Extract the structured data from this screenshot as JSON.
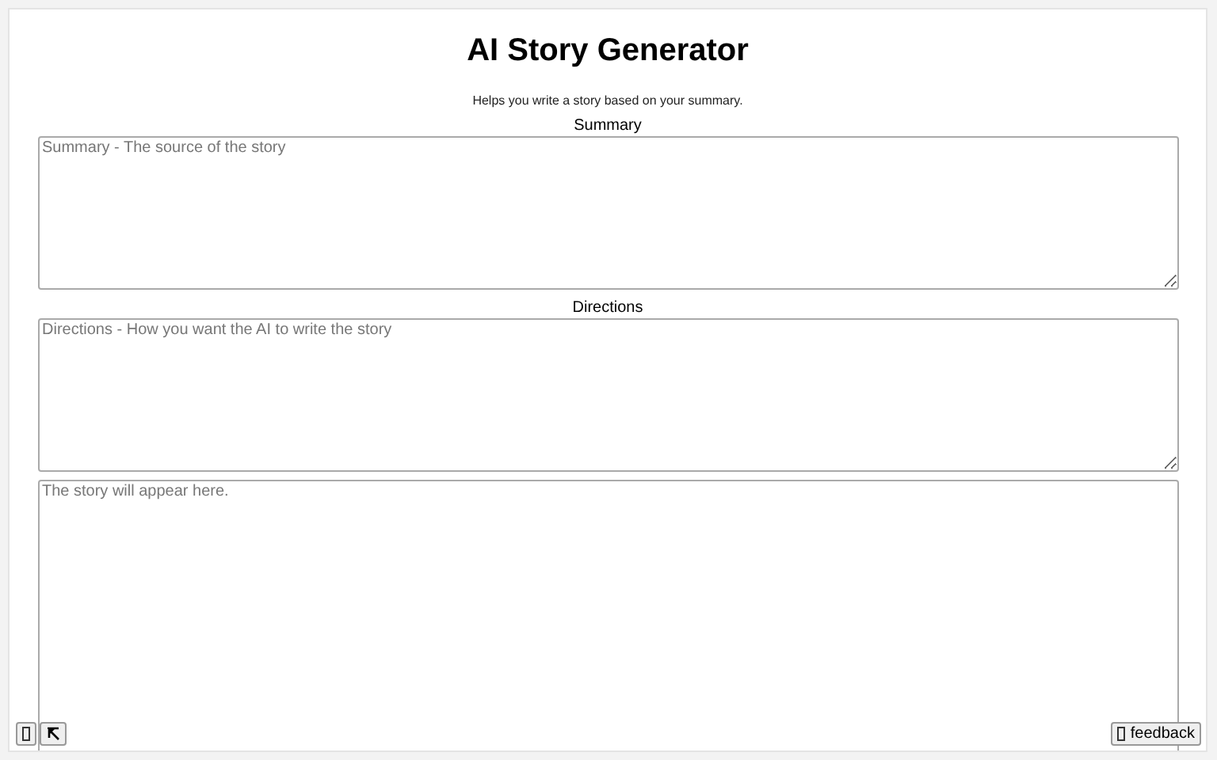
{
  "title": "AI Story Generator",
  "subtitle": "Helps you write a story based on your summary.",
  "fields": [
    {
      "label": "Summary",
      "placeholder": "Summary - The source of the story"
    },
    {
      "label": "Directions",
      "placeholder": "Directions - How you want the AI to write the story"
    },
    {
      "placeholder": "The story will appear here."
    }
  ],
  "corner_buttons": [
    {
      "kind": "box"
    },
    {
      "kind": "expand"
    }
  ],
  "feedback_button": {
    "label": "feedback"
  }
}
